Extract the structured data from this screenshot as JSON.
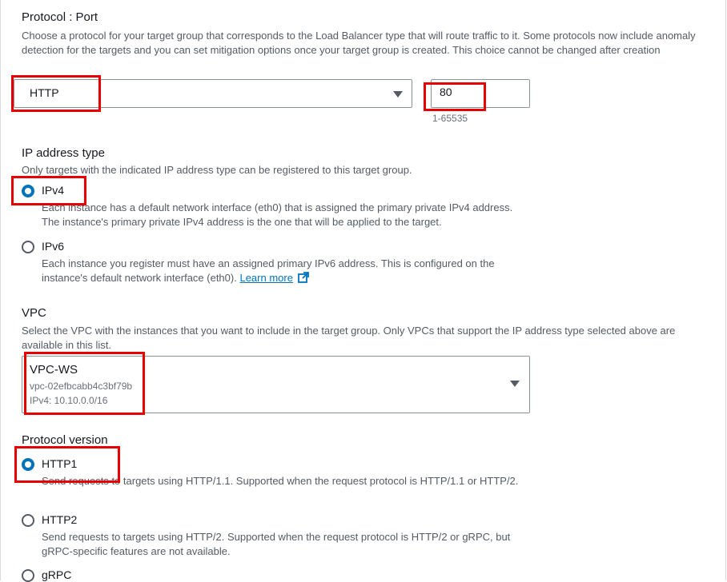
{
  "protocol_port": {
    "label": "Protocol : Port",
    "description": "Choose a protocol for your target group that corresponds to the Load Balancer type that will route traffic to it. Some protocols now include anomaly detection for the targets and you can set mitigation options once your target group is created. This choice cannot be changed after creation",
    "protocol_value": "HTTP",
    "port_value": "80",
    "port_hint": "1-65535"
  },
  "ip_address_type": {
    "label": "IP address type",
    "description": "Only targets with the indicated IP address type can be registered to this target group.",
    "options": [
      {
        "label": "IPv4",
        "description": "Each instance has a default network interface (eth0) that is assigned the primary private IPv4 address. The instance's primary private IPv4 address is the one that will be applied to the target.",
        "selected": true
      },
      {
        "label": "IPv6",
        "description": "Each instance you register must have an assigned primary IPv6 address. This is configured on the instance's default network interface (eth0).",
        "link": "Learn more",
        "selected": false
      }
    ]
  },
  "vpc": {
    "label": "VPC",
    "description": "Select the VPC with the instances that you want to include in the target group. Only VPCs that support the IP address type selected above are available in this list.",
    "name": "VPC-WS",
    "id": "vpc-02efbcabb4c3bf79b",
    "cidr": "IPv4: 10.10.0.0/16"
  },
  "protocol_version": {
    "label": "Protocol version",
    "options": [
      {
        "label": "HTTP1",
        "description": "Send requests to targets using HTTP/1.1. Supported when the request protocol is HTTP/1.1 or HTTP/2.",
        "selected": true
      },
      {
        "label": "HTTP2",
        "description": "Send requests to targets using HTTP/2. Supported when the request protocol is HTTP/2 or gRPC, but gRPC-specific features are not available.",
        "selected": false
      },
      {
        "label": "gRPC",
        "selected": false
      }
    ]
  },
  "colors": {
    "accent": "#0073bb",
    "highlight": "#e80000"
  },
  "icons": {
    "caret": "caret-down-icon",
    "external": "external-link-icon"
  }
}
